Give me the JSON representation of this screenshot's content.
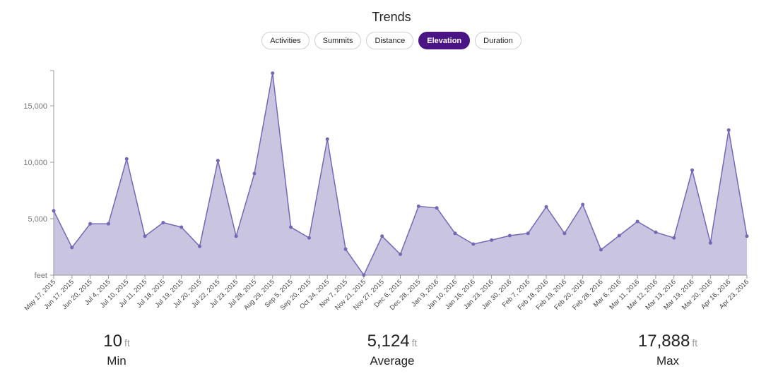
{
  "title": "Trends",
  "tabs": [
    {
      "label": "Activities",
      "active": false
    },
    {
      "label": "Summits",
      "active": false
    },
    {
      "label": "Distance",
      "active": false
    },
    {
      "label": "Elevation",
      "active": true
    },
    {
      "label": "Duration",
      "active": false
    }
  ],
  "colors": {
    "accent": "#4a1487",
    "area_fill": "#c9c5e1",
    "line": "#7368b6",
    "axis": "#999999"
  },
  "stats": {
    "min": {
      "value": "10",
      "unit": "ft",
      "label": "Min"
    },
    "average": {
      "value": "5,124",
      "unit": "ft",
      "label": "Average"
    },
    "max": {
      "value": "17,888",
      "unit": "ft",
      "label": "Max"
    }
  },
  "chart_data": {
    "type": "area",
    "ylim": [
      0,
      18000
    ],
    "yticks": [
      {
        "value": 0,
        "label": "feet"
      },
      {
        "value": 5000,
        "label": "5,000"
      },
      {
        "value": 10000,
        "label": "10,000"
      },
      {
        "value": 15000,
        "label": "15,000"
      }
    ],
    "grid": false,
    "x": [
      "May 17, 2015",
      "Jun 17, 2015",
      "Jun 20, 2015",
      "Jul 4, 2015",
      "Jul 10, 2015",
      "Jul 11, 2015",
      "Jul 18, 2015",
      "Jul 19, 2015",
      "Jul 20, 2015",
      "Jul 22, 2015",
      "Jul 23, 2015",
      "Jul 28, 2015",
      "Aug 29, 2015",
      "Sep 5, 2015",
      "Sep 20, 2015",
      "Oct 24, 2015",
      "Nov 7, 2015",
      "Nov 21, 2015",
      "Nov 27, 2015",
      "Dec 6, 2015",
      "Dec 28, 2015",
      "Jan 9, 2016",
      "Jan 10, 2016",
      "Jan 16, 2016",
      "Jan 23, 2016",
      "Jan 30, 2016",
      "Feb 7, 2016",
      "Feb 18, 2016",
      "Feb 19, 2016",
      "Feb 20, 2016",
      "Feb 28, 2016",
      "Mar 6, 2016",
      "Mar 11, 2016",
      "Mar 12, 2016",
      "Mar 13, 2016",
      "Mar 19, 2016",
      "Mar 20, 2016",
      "Apr 16, 2016",
      "Apr 23, 2016"
    ],
    "values": [
      5700,
      2450,
      4550,
      4550,
      10300,
      3450,
      4650,
      4250,
      2550,
      10150,
      3450,
      9000,
      17888,
      4250,
      3300,
      12050,
      2300,
      10,
      3450,
      1850,
      6100,
      5950,
      3700,
      2750,
      3100,
      3500,
      3700,
      6050,
      3700,
      6250,
      2250,
      3500,
      4750,
      3800,
      3300,
      9300,
      2850,
      12850,
      3450
    ]
  }
}
